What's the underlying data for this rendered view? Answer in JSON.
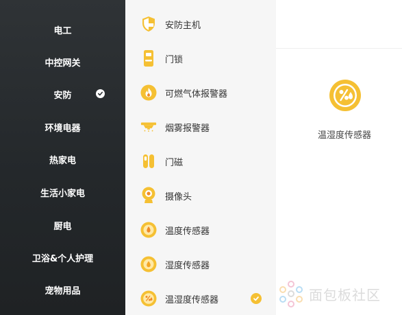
{
  "sidebar": {
    "items": [
      {
        "label": "电工",
        "selected": false
      },
      {
        "label": "中控网关",
        "selected": false
      },
      {
        "label": "安防",
        "selected": true
      },
      {
        "label": "环境电器",
        "selected": false
      },
      {
        "label": "热家电",
        "selected": false
      },
      {
        "label": "生活小家电",
        "selected": false
      },
      {
        "label": "厨电",
        "selected": false
      },
      {
        "label": "卫浴&个人护理",
        "selected": false
      },
      {
        "label": "宠物用品",
        "selected": false
      }
    ]
  },
  "device_list": {
    "items": [
      {
        "label": "安防主机",
        "icon": "shield-icon"
      },
      {
        "label": "门锁",
        "icon": "door-lock-icon"
      },
      {
        "label": "可燃气体报警器",
        "icon": "flame-icon"
      },
      {
        "label": "烟雾报警器",
        "icon": "smoke-alarm-icon"
      },
      {
        "label": "门磁",
        "icon": "door-sensor-icon"
      },
      {
        "label": "摄像头",
        "icon": "camera-icon"
      },
      {
        "label": "温度传感器",
        "icon": "temperature-sensor-icon"
      },
      {
        "label": "湿度传感器",
        "icon": "humidity-sensor-icon"
      },
      {
        "label": "温湿度传感器",
        "icon": "temp-humidity-sensor-icon",
        "selected": true
      }
    ]
  },
  "detail": {
    "title": "温湿度传感器",
    "icon": "temp-humidity-sensor-icon"
  },
  "watermark": {
    "text": "面包板社区"
  },
  "colors": {
    "sidebar_bg": "#2a2e31",
    "accent_yellow": "#f5c033",
    "list_bg": "#f6f6f6"
  }
}
